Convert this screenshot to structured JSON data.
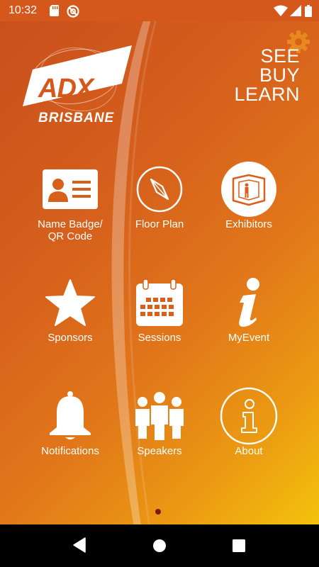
{
  "status_bar": {
    "time": "10:32",
    "icons": [
      "sd-card-icon",
      "no-disturb-icon",
      "wifi-icon",
      "signal-icon",
      "battery-icon"
    ]
  },
  "header": {
    "logo_text": "ADX",
    "logo_subtext": "BRISBANE",
    "tagline": [
      "SEE",
      "BUY",
      "LEARN"
    ],
    "settings_icon": "gear-icon"
  },
  "menu": {
    "items": [
      {
        "label_line1": "Name Badge/",
        "label_line2": "QR Code",
        "icon": "id-badge-icon"
      },
      {
        "label_line1": "Floor Plan",
        "label_line2": "",
        "icon": "compass-icon"
      },
      {
        "label_line1": "Exhibitors",
        "label_line2": "",
        "icon": "exhibitor-booth-icon"
      },
      {
        "label_line1": "Sponsors",
        "label_line2": "",
        "icon": "star-icon"
      },
      {
        "label_line1": "Sessions",
        "label_line2": "",
        "icon": "calendar-icon"
      },
      {
        "label_line1": "MyEvent",
        "label_line2": "",
        "icon": "info-i-icon"
      },
      {
        "label_line1": "Notifications",
        "label_line2": "",
        "icon": "bell-icon"
      },
      {
        "label_line1": "Speakers",
        "label_line2": "",
        "icon": "people-icon"
      },
      {
        "label_line1": "About",
        "label_line2": "",
        "icon": "info-circle-icon"
      }
    ]
  },
  "page_indicator": {
    "current": 1,
    "total": 1
  },
  "nav_bar": {
    "buttons": [
      "back-icon",
      "home-icon",
      "recents-icon"
    ]
  },
  "colors": {
    "status_bar": "#d4571b",
    "gradient_start": "#c9501c",
    "gradient_end": "#f3c30c",
    "gear": "#e8891f",
    "page_dot": "#7a1a12"
  }
}
